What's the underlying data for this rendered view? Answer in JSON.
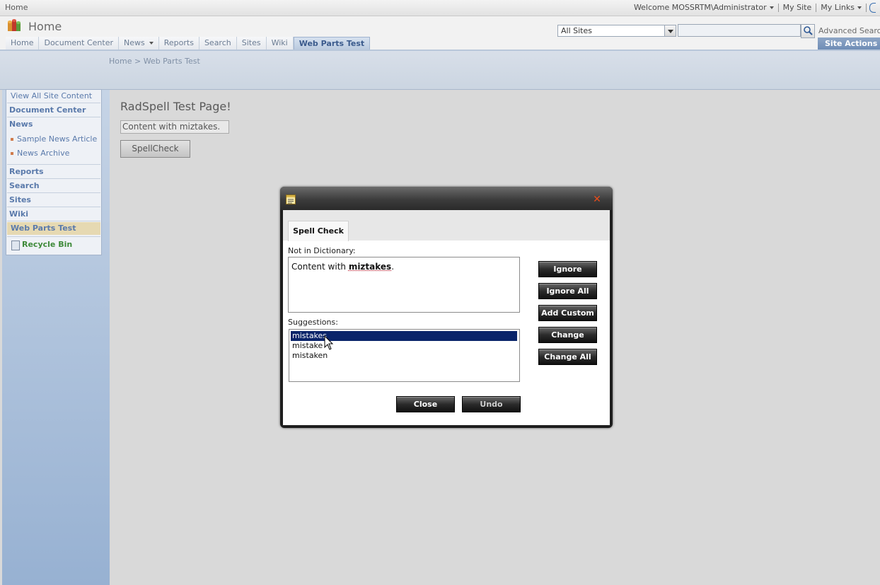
{
  "topbar": {
    "crumb": "Home",
    "welcome": "Welcome MOSSRTM\\Administrator",
    "my_site": "My Site",
    "my_links": "My Links"
  },
  "header": {
    "site_title": "Home",
    "scope_select": "All Sites",
    "search_value": "",
    "advanced_search": "Advanced Search",
    "search_icon": "magnifier-icon",
    "logo_icon": "sharepoint-logo-icon"
  },
  "nav": {
    "tabs": [
      {
        "label": "Home"
      },
      {
        "label": "Document Center"
      },
      {
        "label": "News"
      },
      {
        "label": "Reports"
      },
      {
        "label": "Search"
      },
      {
        "label": "Sites"
      },
      {
        "label": "Wiki"
      },
      {
        "label": "Web Parts Test"
      }
    ],
    "selected_tab": "Web Parts Test",
    "site_actions": "Site Actions"
  },
  "breadcrumb": "Home > Web Parts Test",
  "quicklaunch": {
    "view_all": "View All Site Content",
    "document_center": "Document Center",
    "news": "News",
    "news_sub": [
      "Sample News Article",
      "News Archive"
    ],
    "reports": "Reports",
    "search": "Search",
    "sites": "Sites",
    "wiki": "Wiki",
    "web_parts_test": "Web Parts Test",
    "recycle_bin": "Recycle Bin"
  },
  "main": {
    "page_title": "RadSpell Test Page!",
    "content_value": "Content with miztakes.",
    "spellcheck_button": "SpellCheck"
  },
  "dialog": {
    "tab": "Spell Check",
    "not_in_dictionary_label": "Not in Dictionary:",
    "text_before": "Content with ",
    "misspelled": "miztakes",
    "text_after": ".",
    "suggestions_label": "Suggestions:",
    "suggestions": [
      "mistakes",
      "mistake",
      "mistaken"
    ],
    "selected_suggestion": "mistakes",
    "buttons": {
      "ignore": "Ignore",
      "ignore_all": "Ignore All",
      "add_custom": "Add Custom",
      "change": "Change",
      "change_all": "Change All",
      "close": "Close",
      "undo": "Undo"
    },
    "close_icon": "close-x-icon",
    "title_icon": "notepad-icon"
  },
  "colors": {
    "accent_blue": "#5a7aab",
    "close_red": "#e74c1b",
    "selection": "#0a246a"
  }
}
